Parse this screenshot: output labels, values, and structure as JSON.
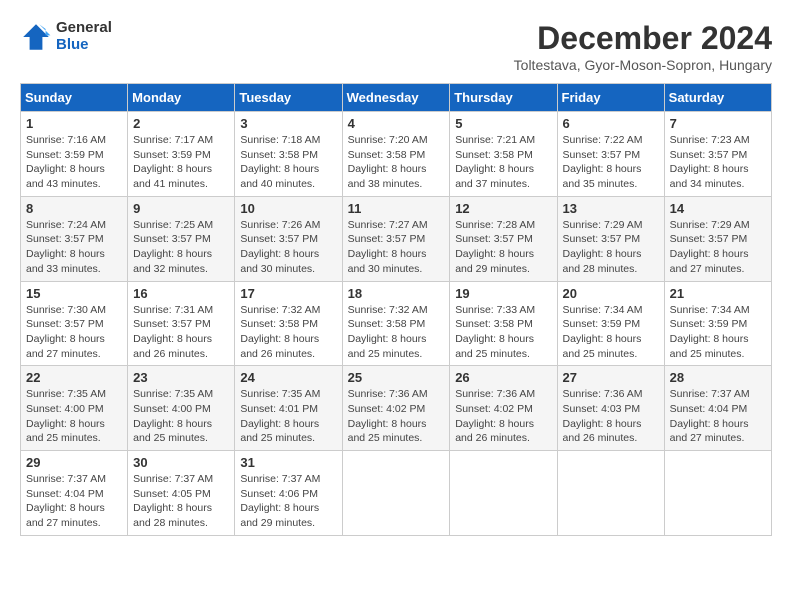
{
  "logo": {
    "general": "General",
    "blue": "Blue"
  },
  "header": {
    "month": "December 2024",
    "location": "Toltestava, Gyor-Moson-Sopron, Hungary"
  },
  "weekdays": [
    "Sunday",
    "Monday",
    "Tuesday",
    "Wednesday",
    "Thursday",
    "Friday",
    "Saturday"
  ],
  "weeks": [
    [
      {
        "day": "1",
        "sunrise": "Sunrise: 7:16 AM",
        "sunset": "Sunset: 3:59 PM",
        "daylight": "Daylight: 8 hours and 43 minutes."
      },
      {
        "day": "2",
        "sunrise": "Sunrise: 7:17 AM",
        "sunset": "Sunset: 3:59 PM",
        "daylight": "Daylight: 8 hours and 41 minutes."
      },
      {
        "day": "3",
        "sunrise": "Sunrise: 7:18 AM",
        "sunset": "Sunset: 3:58 PM",
        "daylight": "Daylight: 8 hours and 40 minutes."
      },
      {
        "day": "4",
        "sunrise": "Sunrise: 7:20 AM",
        "sunset": "Sunset: 3:58 PM",
        "daylight": "Daylight: 8 hours and 38 minutes."
      },
      {
        "day": "5",
        "sunrise": "Sunrise: 7:21 AM",
        "sunset": "Sunset: 3:58 PM",
        "daylight": "Daylight: 8 hours and 37 minutes."
      },
      {
        "day": "6",
        "sunrise": "Sunrise: 7:22 AM",
        "sunset": "Sunset: 3:57 PM",
        "daylight": "Daylight: 8 hours and 35 minutes."
      },
      {
        "day": "7",
        "sunrise": "Sunrise: 7:23 AM",
        "sunset": "Sunset: 3:57 PM",
        "daylight": "Daylight: 8 hours and 34 minutes."
      }
    ],
    [
      {
        "day": "8",
        "sunrise": "Sunrise: 7:24 AM",
        "sunset": "Sunset: 3:57 PM",
        "daylight": "Daylight: 8 hours and 33 minutes."
      },
      {
        "day": "9",
        "sunrise": "Sunrise: 7:25 AM",
        "sunset": "Sunset: 3:57 PM",
        "daylight": "Daylight: 8 hours and 32 minutes."
      },
      {
        "day": "10",
        "sunrise": "Sunrise: 7:26 AM",
        "sunset": "Sunset: 3:57 PM",
        "daylight": "Daylight: 8 hours and 30 minutes."
      },
      {
        "day": "11",
        "sunrise": "Sunrise: 7:27 AM",
        "sunset": "Sunset: 3:57 PM",
        "daylight": "Daylight: 8 hours and 30 minutes."
      },
      {
        "day": "12",
        "sunrise": "Sunrise: 7:28 AM",
        "sunset": "Sunset: 3:57 PM",
        "daylight": "Daylight: 8 hours and 29 minutes."
      },
      {
        "day": "13",
        "sunrise": "Sunrise: 7:29 AM",
        "sunset": "Sunset: 3:57 PM",
        "daylight": "Daylight: 8 hours and 28 minutes."
      },
      {
        "day": "14",
        "sunrise": "Sunrise: 7:29 AM",
        "sunset": "Sunset: 3:57 PM",
        "daylight": "Daylight: 8 hours and 27 minutes."
      }
    ],
    [
      {
        "day": "15",
        "sunrise": "Sunrise: 7:30 AM",
        "sunset": "Sunset: 3:57 PM",
        "daylight": "Daylight: 8 hours and 27 minutes."
      },
      {
        "day": "16",
        "sunrise": "Sunrise: 7:31 AM",
        "sunset": "Sunset: 3:57 PM",
        "daylight": "Daylight: 8 hours and 26 minutes."
      },
      {
        "day": "17",
        "sunrise": "Sunrise: 7:32 AM",
        "sunset": "Sunset: 3:58 PM",
        "daylight": "Daylight: 8 hours and 26 minutes."
      },
      {
        "day": "18",
        "sunrise": "Sunrise: 7:32 AM",
        "sunset": "Sunset: 3:58 PM",
        "daylight": "Daylight: 8 hours and 25 minutes."
      },
      {
        "day": "19",
        "sunrise": "Sunrise: 7:33 AM",
        "sunset": "Sunset: 3:58 PM",
        "daylight": "Daylight: 8 hours and 25 minutes."
      },
      {
        "day": "20",
        "sunrise": "Sunrise: 7:34 AM",
        "sunset": "Sunset: 3:59 PM",
        "daylight": "Daylight: 8 hours and 25 minutes."
      },
      {
        "day": "21",
        "sunrise": "Sunrise: 7:34 AM",
        "sunset": "Sunset: 3:59 PM",
        "daylight": "Daylight: 8 hours and 25 minutes."
      }
    ],
    [
      {
        "day": "22",
        "sunrise": "Sunrise: 7:35 AM",
        "sunset": "Sunset: 4:00 PM",
        "daylight": "Daylight: 8 hours and 25 minutes."
      },
      {
        "day": "23",
        "sunrise": "Sunrise: 7:35 AM",
        "sunset": "Sunset: 4:00 PM",
        "daylight": "Daylight: 8 hours and 25 minutes."
      },
      {
        "day": "24",
        "sunrise": "Sunrise: 7:35 AM",
        "sunset": "Sunset: 4:01 PM",
        "daylight": "Daylight: 8 hours and 25 minutes."
      },
      {
        "day": "25",
        "sunrise": "Sunrise: 7:36 AM",
        "sunset": "Sunset: 4:02 PM",
        "daylight": "Daylight: 8 hours and 25 minutes."
      },
      {
        "day": "26",
        "sunrise": "Sunrise: 7:36 AM",
        "sunset": "Sunset: 4:02 PM",
        "daylight": "Daylight: 8 hours and 26 minutes."
      },
      {
        "day": "27",
        "sunrise": "Sunrise: 7:36 AM",
        "sunset": "Sunset: 4:03 PM",
        "daylight": "Daylight: 8 hours and 26 minutes."
      },
      {
        "day": "28",
        "sunrise": "Sunrise: 7:37 AM",
        "sunset": "Sunset: 4:04 PM",
        "daylight": "Daylight: 8 hours and 27 minutes."
      }
    ],
    [
      {
        "day": "29",
        "sunrise": "Sunrise: 7:37 AM",
        "sunset": "Sunset: 4:04 PM",
        "daylight": "Daylight: 8 hours and 27 minutes."
      },
      {
        "day": "30",
        "sunrise": "Sunrise: 7:37 AM",
        "sunset": "Sunset: 4:05 PM",
        "daylight": "Daylight: 8 hours and 28 minutes."
      },
      {
        "day": "31",
        "sunrise": "Sunrise: 7:37 AM",
        "sunset": "Sunset: 4:06 PM",
        "daylight": "Daylight: 8 hours and 29 minutes."
      },
      null,
      null,
      null,
      null
    ]
  ]
}
